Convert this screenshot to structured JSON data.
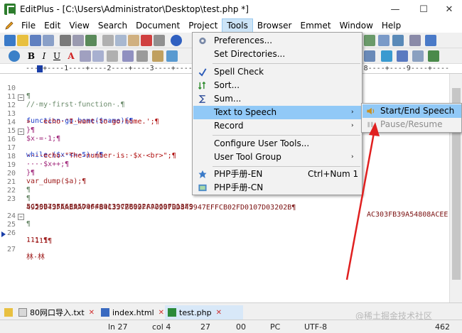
{
  "window": {
    "title": "EditPlus - [C:\\Users\\Administrator\\Desktop\\test.php *]",
    "min_glyph": "—",
    "max_glyph": "☐",
    "close_glyph": "✕"
  },
  "menubar": {
    "items": [
      "File",
      "Edit",
      "View",
      "Search",
      "Document",
      "Project",
      "Tools",
      "Browser",
      "Emmet",
      "Window",
      "Help"
    ],
    "active": "Tools"
  },
  "toolbar_format": {
    "bold": "B",
    "italic": "I",
    "underline": "U",
    "font_color": "A"
  },
  "ruler": {
    "text": "----+----1----+----2----+----3----+----4----+----5----+----6----+----7----+----8----+----9----+----"
  },
  "editor": {
    "lines": [
      {
        "n": "10",
        "text": "¶"
      },
      {
        "n": "11",
        "text": "//·my·first·function·.¶"
      },
      {
        "n": "12",
        "text": "function·go_home($name){¶"
      },
      {
        "n": "13",
        "text": "»   echo·'I·want·to·go·home.';¶"
      },
      {
        "n": "14",
        "text": "}¶"
      },
      {
        "n": "15",
        "text": "$x·=·1;¶"
      },
      {
        "n": "16",
        "text": "while·($x·<=·5)·{¶"
      },
      {
        "n": "17",
        "text": "····echo·\"The·number·is:·$x·<br>\";¶"
      },
      {
        "n": "18",
        "text": "····$x++;¶"
      },
      {
        "n": "19",
        "text": "}¶"
      },
      {
        "n": "20",
        "text": "var_dump($a);¶"
      },
      {
        "n": "21",
        "text": "¶"
      },
      {
        "n": "22",
        "text": "¶"
      },
      {
        "n": "23",
        "text": "5C50B795E6E95D96489139C7B922AA269FD13F9"
      },
      {
        "n": "23b",
        "text": "4925943FAABAA74FFB4C337B609FF70207BD845947EFFCB02FD0107D03202B¶"
      },
      {
        "n": "24",
        "text": "¶"
      },
      {
        "n": "25",
        "text": "111·¶"
      },
      {
        "n": "26",
        "text": "··111¶"
      },
      {
        "n": "27",
        "text": "林·林"
      }
    ],
    "line23_tail": "AC303FB39A54808ACEE"
  },
  "tools_menu": {
    "items": [
      {
        "label": "Preferences...",
        "icon": "gear-icon"
      },
      {
        "label": "Set Directories..."
      },
      {
        "label": "Spell Check",
        "icon": "spell-check-icon"
      },
      {
        "label": "Sort...",
        "icon": "sort-icon"
      },
      {
        "label": "Sum...",
        "icon": "sigma-icon"
      },
      {
        "label": "Text to Speech",
        "submenu": true,
        "highlighted": true
      },
      {
        "label": "Record",
        "submenu": true
      },
      {
        "label": "Configure User Tools..."
      },
      {
        "label": "User Tool Group",
        "submenu": true
      },
      {
        "label": "PHP手册-EN",
        "shortcut": "Ctrl+Num 1",
        "icon": "php-manual-icon"
      },
      {
        "label": "PHP手册-CN",
        "icon": "php-manual-cn-icon"
      }
    ],
    "submenu_arrow": "›"
  },
  "speech_submenu": {
    "items": [
      {
        "label": "Start/End Speech",
        "icon": "speaker-icon",
        "highlighted": true
      },
      {
        "label": "Pause/Resume",
        "disabled": true
      }
    ]
  },
  "tabs": [
    {
      "label": "80网口导入.txt"
    },
    {
      "label": "index.html"
    },
    {
      "label": "test.php",
      "active": true
    }
  ],
  "tab_close_glyph": "✕",
  "statusbar": {
    "ln": "ln 27",
    "col": "col 4",
    "val": "27",
    "code": "00",
    "eol": "PC",
    "encoding": "UTF-8",
    "size": "462"
  },
  "watermark": "@稀土掘金技术社区",
  "colors": {
    "menu_highlight": "#91c9f7",
    "annotation_arrow": "#e02020",
    "keyword": "#1e3ec8",
    "variable": "#a0267a",
    "string": "#b01010"
  }
}
